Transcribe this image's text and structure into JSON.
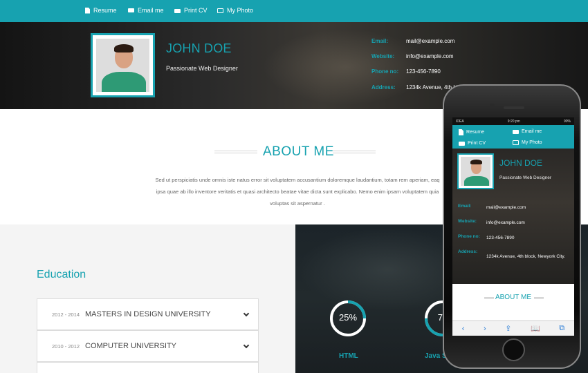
{
  "nav": {
    "items": [
      {
        "label": "Resume",
        "icon": "document-icon"
      },
      {
        "label": "Email me",
        "icon": "envelope-icon"
      },
      {
        "label": "Print CV",
        "icon": "printer-icon"
      },
      {
        "label": "My Photo",
        "icon": "picture-icon"
      }
    ]
  },
  "profile": {
    "name": "JOHN DOE",
    "role": "Passionate Web Designer",
    "contacts": [
      {
        "label": "Email:",
        "value": "mail@example.com"
      },
      {
        "label": "Website:",
        "value": "info@example.com"
      },
      {
        "label": "Phone no:",
        "value": "123-456-7890"
      },
      {
        "label": "Address:",
        "value": "1234k Avenue, 4th bl"
      }
    ]
  },
  "about": {
    "title": "ABOUT ME",
    "lines": [
      "Sed ut perspiciatis unde omnis iste natus error sit voluptatem accusantium doloremque laudantium, totam rem aperiam, eaq",
      "ipsa quae ab illo inventore veritatis et quasi architecto beatae vitae dicta sunt explicabo. Nemo enim ipsam voluptatem quia",
      "voluptas sit aspernatur ."
    ]
  },
  "education": {
    "title": "Education",
    "items": [
      {
        "years": "2012 - 2014",
        "degree": "MASTERS IN DESIGN UNIVERSITY"
      },
      {
        "years": "2010 - 2012",
        "degree": "COMPUTER UNIVERSITY"
      }
    ]
  },
  "skills": {
    "items": [
      {
        "name": "HTML",
        "percent": 25,
        "label": "25%"
      },
      {
        "name": "Java S",
        "percent": 75,
        "label": "75"
      }
    ]
  },
  "mobile": {
    "status": {
      "carrier": "IDEA",
      "time": "9:20 pm",
      "battery": "90%"
    },
    "nav": {
      "items": [
        {
          "label": "Resume",
          "icon": "document-icon"
        },
        {
          "label": "Email me",
          "icon": "envelope-icon"
        },
        {
          "label": "Print CV",
          "icon": "printer-icon"
        },
        {
          "label": "My Photo",
          "icon": "picture-icon"
        }
      ]
    },
    "name": "JOHN DOE",
    "role": "Passionate Web Designer",
    "contacts": [
      {
        "label": "Email:",
        "value": "mail@example.com"
      },
      {
        "label": "Website:",
        "value": "info@example.com"
      },
      {
        "label": "Phone no:",
        "value": "123-456-7890"
      },
      {
        "label": "Address:",
        "value": "1234k Avenue, 4th block, Newyork City."
      }
    ],
    "about_title": "ABOUT ME",
    "toolbar": {
      "back": "‹",
      "forward": "›",
      "share": "⇪",
      "bookmarks": "📖",
      "tabs": "⧉"
    }
  },
  "colors": {
    "accent": "#17a2b0",
    "nav_bg": "#17a2b0"
  }
}
